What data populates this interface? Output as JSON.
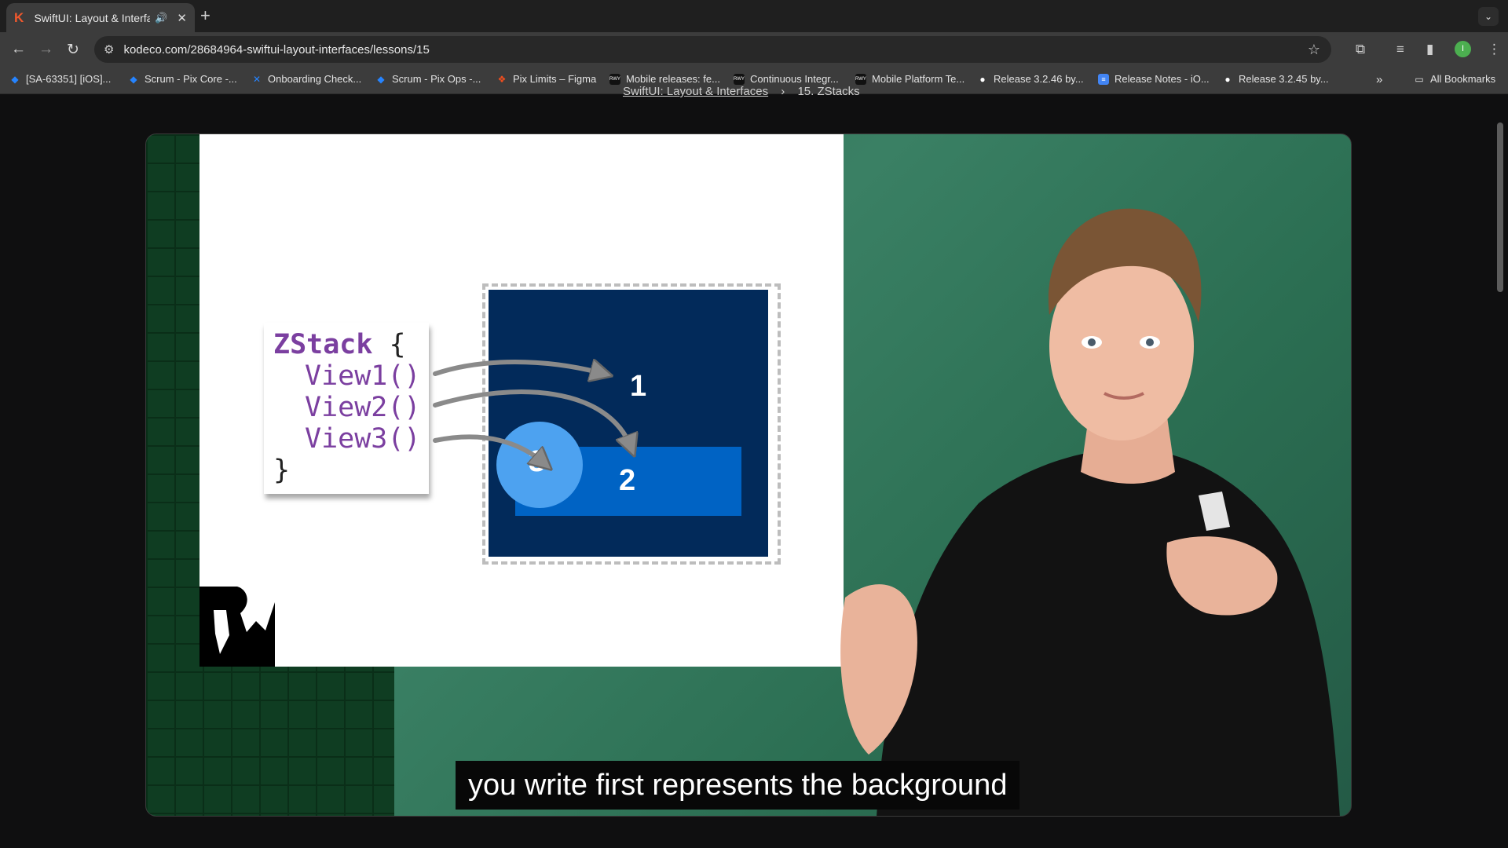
{
  "browser": {
    "tab": {
      "title": "SwiftUI: Layout & Interfac",
      "favicon": "K"
    },
    "address": {
      "url": "kodeco.com/28684964-swiftui-layout-interfaces/lessons/15"
    },
    "bookmarks": [
      {
        "label": "[SA-63351] [iOS]...",
        "icon": "jira-icon"
      },
      {
        "label": "Scrum - Pix Core -...",
        "icon": "jira-icon"
      },
      {
        "label": "Onboarding Check...",
        "icon": "jira-icon"
      },
      {
        "label": "Scrum - Pix Ops -...",
        "icon": "jira-icon"
      },
      {
        "label": "Pix Limits – Figma",
        "icon": "figma-icon"
      },
      {
        "label": "Mobile releases: fe...",
        "icon": "rwy-icon"
      },
      {
        "label": "Continuous Integr...",
        "icon": "rwy-icon"
      },
      {
        "label": "Mobile Platform Te...",
        "icon": "rwy-icon"
      },
      {
        "label": "Release 3.2.46 by...",
        "icon": "github-icon"
      },
      {
        "label": "Release Notes - iO...",
        "icon": "doc-icon"
      },
      {
        "label": "Release 3.2.45 by...",
        "icon": "github-icon"
      }
    ],
    "all_bookmarks": "All Bookmarks",
    "profile_initial": "I"
  },
  "page": {
    "breadcrumb": {
      "course": "SwiftUI: Layout & Interfaces",
      "lesson": "15. ZStacks"
    }
  },
  "video": {
    "slide": {
      "code_keyword": "ZStack",
      "open_brace": "{",
      "close_brace": "}",
      "code_lines": [
        "View1()",
        "View2()",
        "View3()"
      ],
      "view_labels": [
        "1",
        "2",
        "3"
      ]
    },
    "caption": "you write first represents the background"
  }
}
